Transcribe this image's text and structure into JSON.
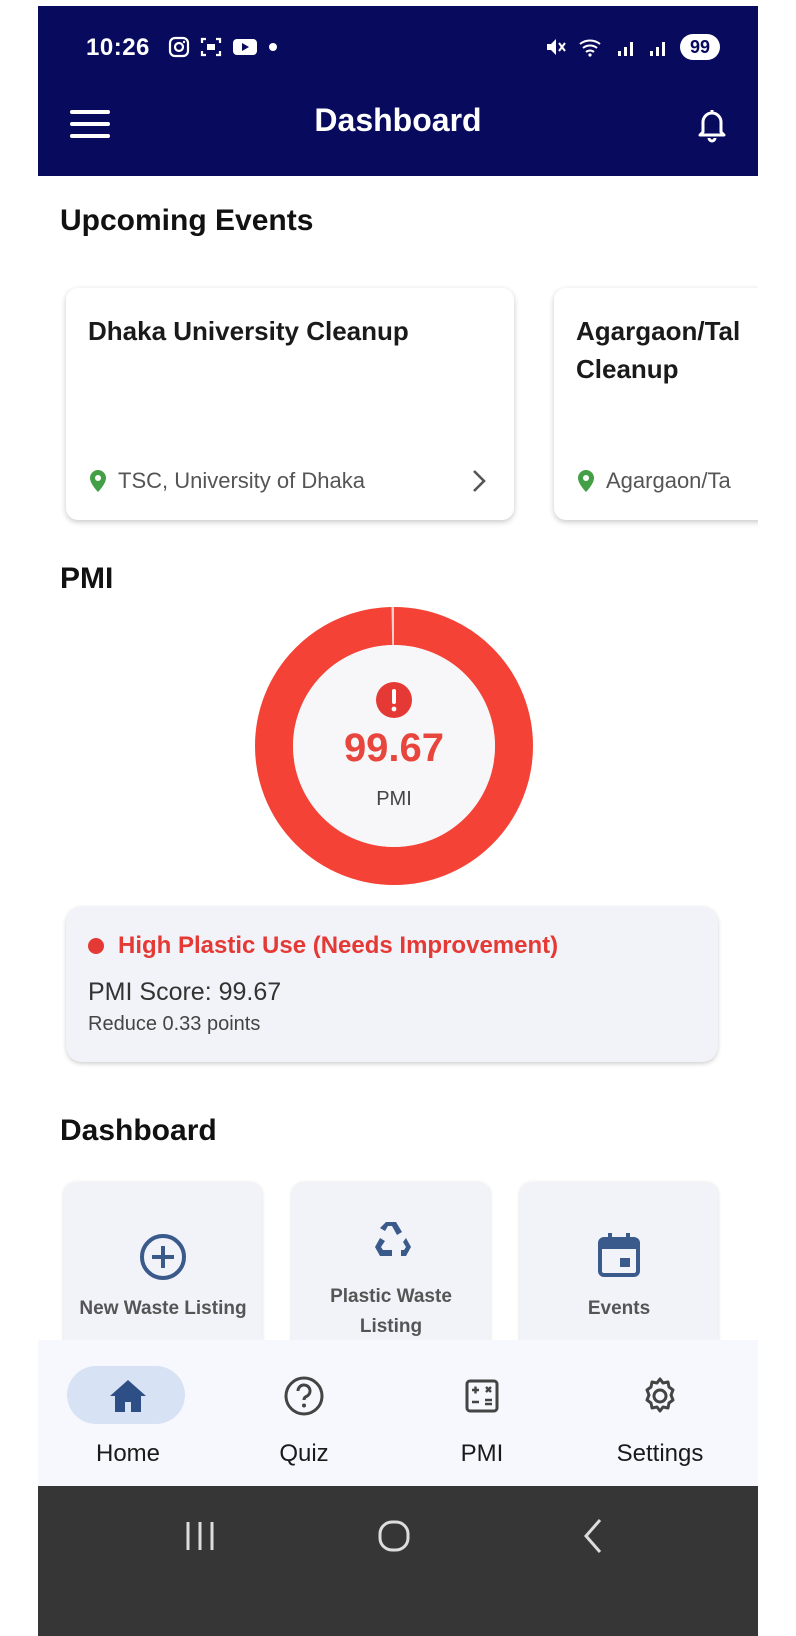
{
  "status_bar": {
    "time": "10:26",
    "battery": "99"
  },
  "app_bar": {
    "title": "Dashboard"
  },
  "upcoming": {
    "title": "Upcoming Events",
    "events": [
      {
        "title_lines": [
          "Dhaka University Cleanup"
        ],
        "location": "TSC, University of Dhaka"
      },
      {
        "title_lines": [
          "Agargaon/Tal",
          "Cleanup"
        ],
        "location": "Agargaon/Ta"
      }
    ]
  },
  "pmi": {
    "section_title": "PMI",
    "value": "99.67",
    "fraction": 0.9967,
    "label": "PMI",
    "color": "#F44336",
    "status": {
      "heading": "High Plastic Use (Needs Improvement)",
      "score": "PMI Score: 99.67",
      "sub": "Reduce 0.33 points"
    }
  },
  "dashboard": {
    "title": "Dashboard",
    "tiles": [
      {
        "label_lines": [
          "New Waste Listing"
        ],
        "icon": "add-circle-icon"
      },
      {
        "label_lines": [
          "Plastic Waste",
          "Listing"
        ],
        "icon": "recycle-icon"
      },
      {
        "label_lines": [
          "Events"
        ],
        "icon": "calendar-icon"
      }
    ]
  },
  "bottom_nav": {
    "items": [
      {
        "label": "Home",
        "icon": "home-icon",
        "active": true
      },
      {
        "label": "Quiz",
        "icon": "help-circle-icon",
        "active": false
      },
      {
        "label": "PMI",
        "icon": "calculator-icon",
        "active": false
      },
      {
        "label": "Settings",
        "icon": "gear-icon",
        "active": false
      }
    ]
  },
  "colors": {
    "primary": "#080A5E",
    "accent": "#3B5A8C",
    "danger": "#E53935",
    "location_pin": "#43A047"
  }
}
